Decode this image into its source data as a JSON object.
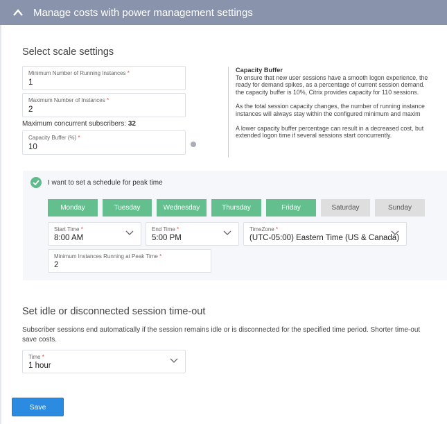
{
  "header": {
    "title": "Manage costs with power management settings",
    "icon": "chevron-up-icon"
  },
  "scale": {
    "heading": "Select scale settings",
    "min_instances": {
      "label": "Minimum Number of Running Instances",
      "required": "*",
      "value": "1"
    },
    "max_instances": {
      "label": "Maximum Number of Instances",
      "required": "*",
      "value": "2"
    },
    "max_subscribers_label": "Maximum concurrent subscribers:",
    "max_subscribers_value": "32",
    "capacity_buffer": {
      "label": "Capacity Buffer (%)",
      "required": "*",
      "value": "10"
    },
    "help_icon": "question-circle-icon"
  },
  "info": {
    "title": "Capacity Buffer",
    "lines1": [
      "To ensure that new user sessions have a smooth logon experience, the",
      "ready for demand spikes, as a percentage of current session demand.",
      "the capacity buffer is 10%, Citrix provides capacity for 110 sessions."
    ],
    "lines2": [
      "As the total session capacity changes, the number of running instance",
      "instances will always stay within the configured minimum and maxim"
    ],
    "lines3": [
      "A lower capacity buffer percentage can result in a decreased cost, but",
      "extended logon time if several sessions start concurrently."
    ]
  },
  "peak": {
    "checkbox_label": "I want to set a schedule for peak time",
    "checked": true,
    "days": [
      {
        "label": "Monday",
        "selected": true
      },
      {
        "label": "Tuesday",
        "selected": true
      },
      {
        "label": "Wednesday",
        "selected": true
      },
      {
        "label": "Thursday",
        "selected": true
      },
      {
        "label": "Friday",
        "selected": true
      },
      {
        "label": "Saturday",
        "selected": false
      },
      {
        "label": "Sunday",
        "selected": false
      }
    ],
    "start_time": {
      "label": "Start Time",
      "required": "*",
      "value": "8:00 AM"
    },
    "end_time": {
      "label": "End Time",
      "required": "*",
      "value": "5:00 PM"
    },
    "timezone": {
      "label": "TimeZone",
      "required": "*",
      "value": "(UTC-05:00) Eastern Time (US & Canada)"
    },
    "min_peak": {
      "label": "Minimum Instances Running at Peak Time",
      "required": "*",
      "value": "2"
    }
  },
  "timeout": {
    "heading": "Set idle or disconnected session time-out",
    "line1": "Subscriber sessions end automatically if the session remains idle or is disconnected for the specified time period. Shorter time-out",
    "line2": "save costs.",
    "time": {
      "label": "Time",
      "required": "*",
      "value": "1 hour"
    }
  },
  "actions": {
    "save_label": "Save"
  },
  "colors": {
    "header_bg": "#8993ab",
    "day_selected": "#63bf8e",
    "day_unselected": "#dedede",
    "primary_button": "#2b8be0",
    "required": "#e0443e"
  }
}
